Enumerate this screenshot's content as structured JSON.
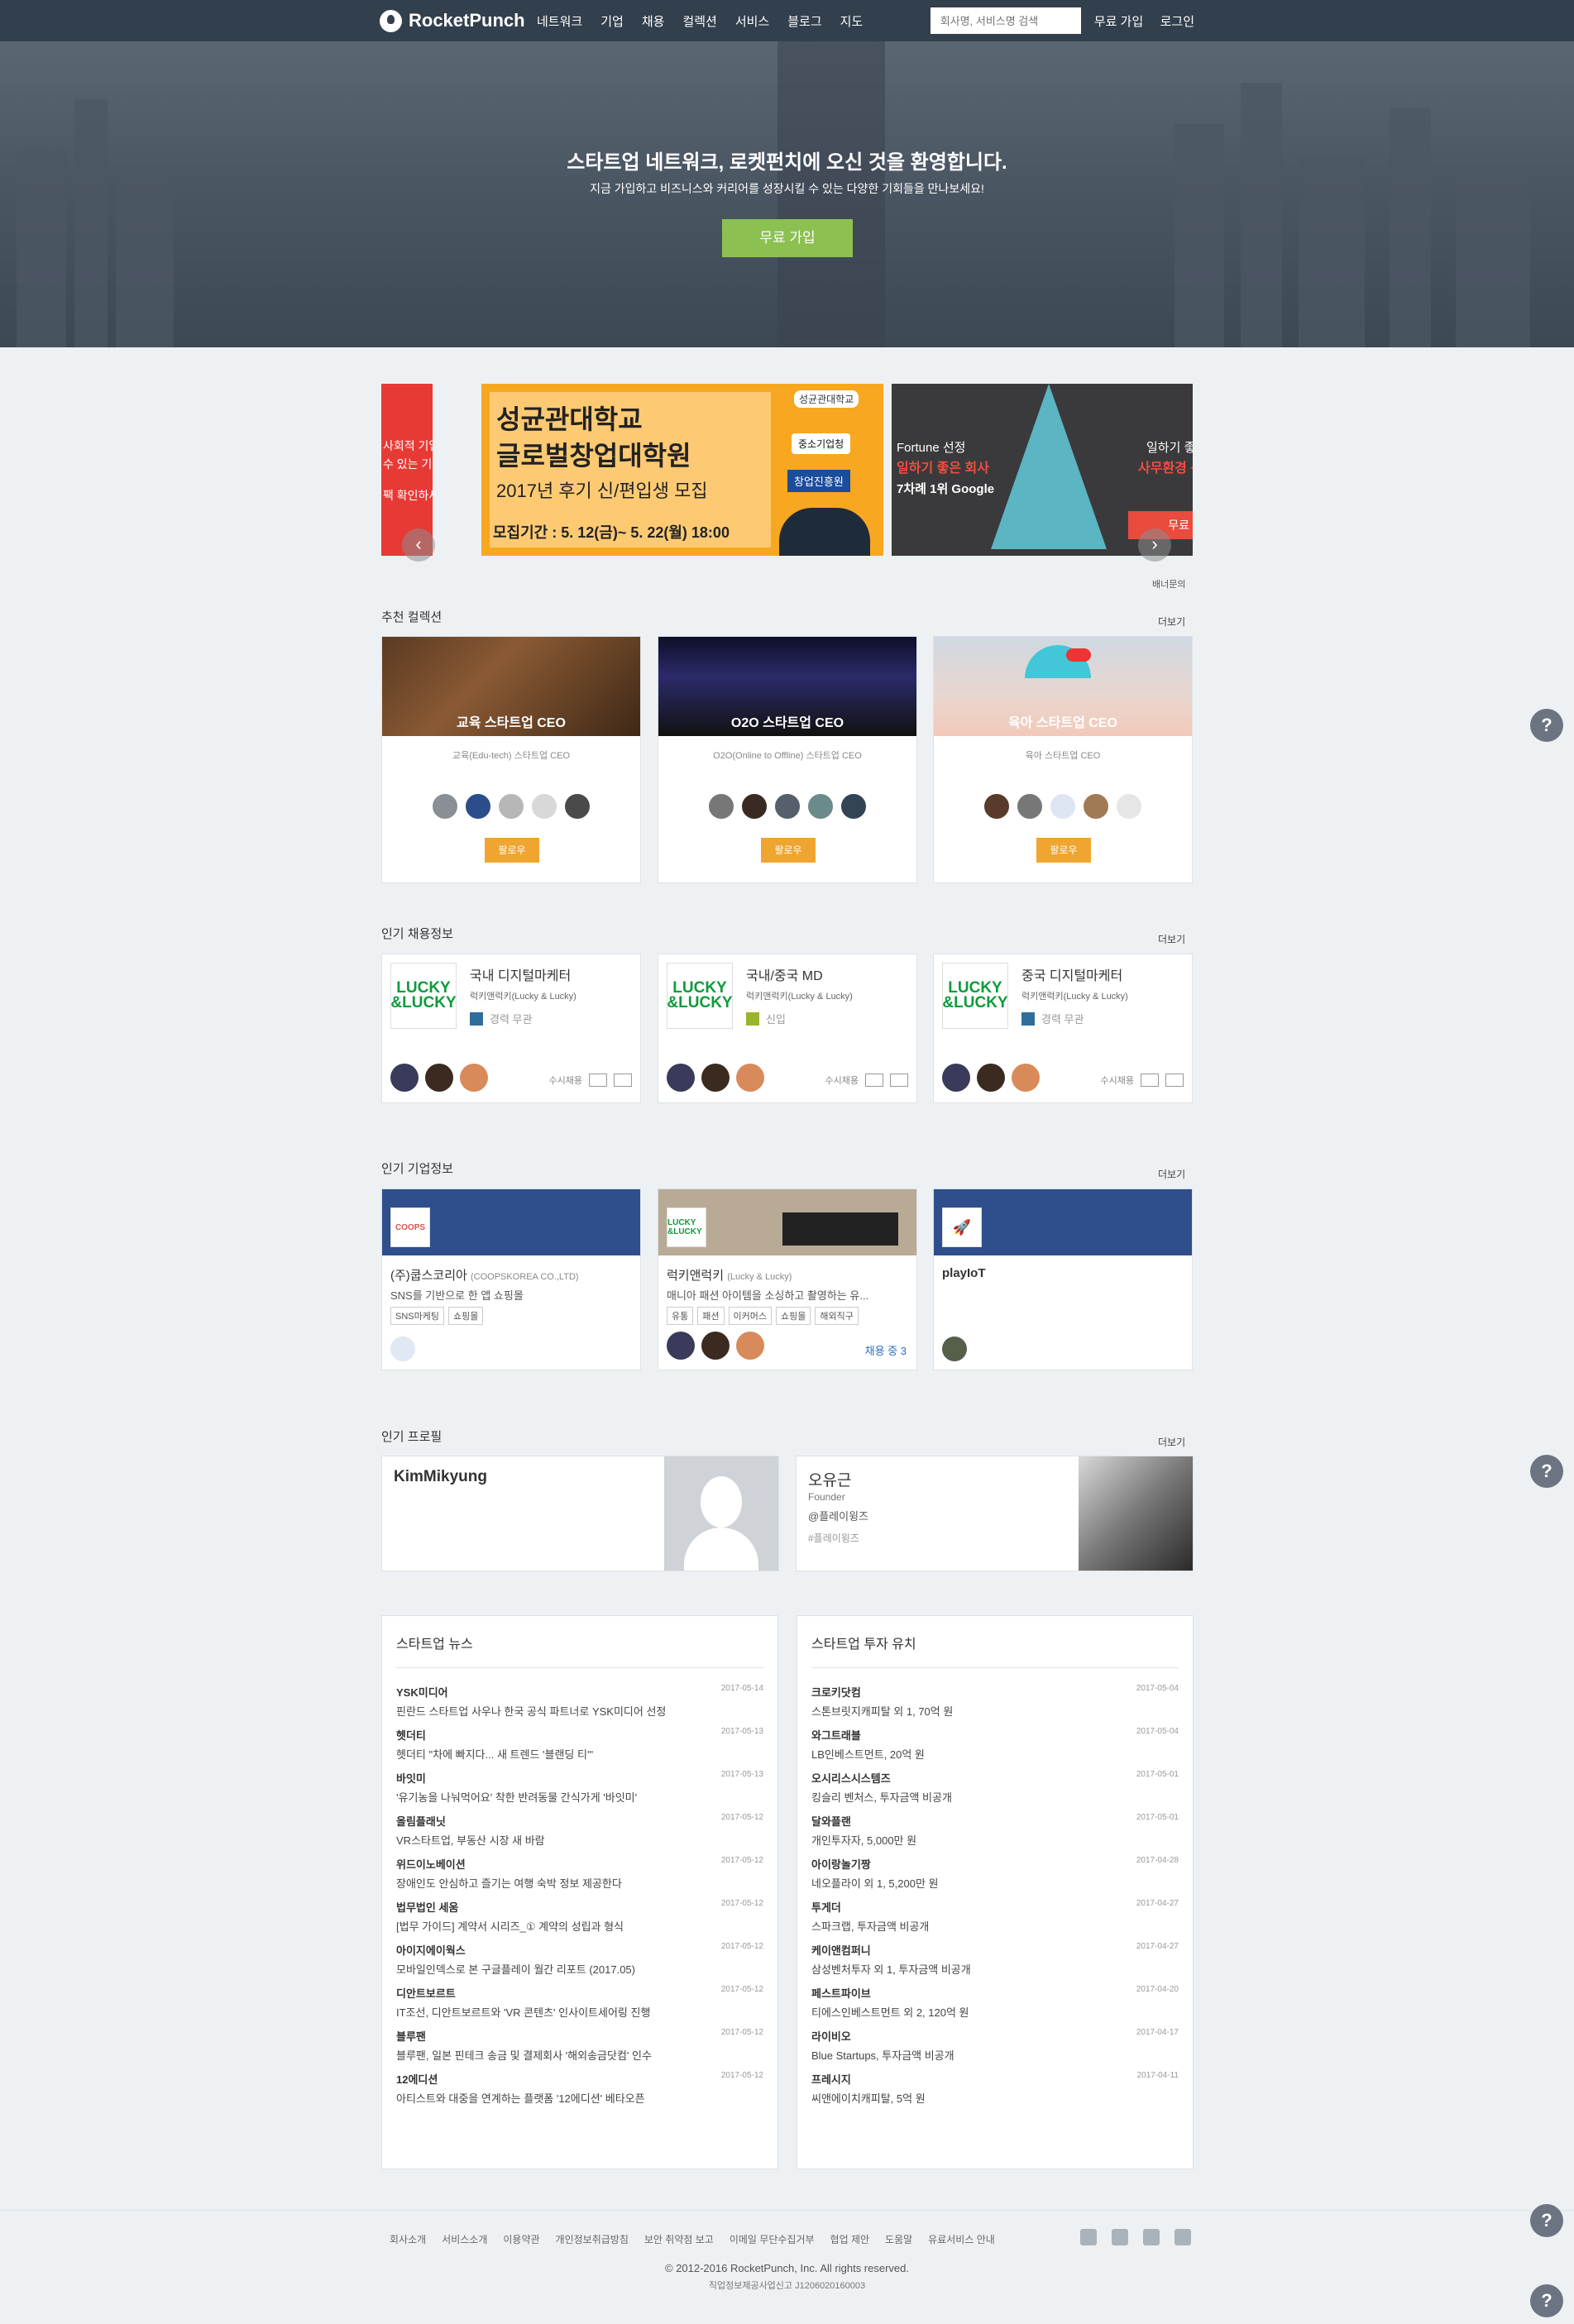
{
  "nav": {
    "logo": "RocketPunch",
    "menu": [
      "네트워크",
      "기업",
      "채용",
      "컬렉션",
      "서비스",
      "블로그",
      "지도"
    ],
    "search_placeholder": "회사명, 서비스명 검색",
    "signup": "무료 가입",
    "login": "로그인"
  },
  "hero": {
    "title": "스타트업 네트워크, 로켓펀치에 오신 것을 환영합니다.",
    "subtitle": "지금 가입하고 비즈니스와 커리어를 성장시킬 수 있는 다양한 기회들을 만나보세요!",
    "cta": "무료 가입"
  },
  "banners": {
    "left": {
      "line1": "사회적 기업을",
      "line2": "수 있는 기회!",
      "line3": "팩 확인하세요!"
    },
    "center": {
      "title1": "성균관대학교",
      "title2": "글로벌창업대학원",
      "sub": "2017년 후기 신/편입생 모집",
      "period": "모집기간 : 5. 12(금)~ 5. 22(월) 18:00",
      "badge1": "성균관대학교",
      "badge2": "중소기업청",
      "badge3": "창업진흥원"
    },
    "right": {
      "line1": "Fortune 선정",
      "line2": "일하기 좋은 회사",
      "line3": "7차례 1위 Google",
      "line4": "일하기 좋",
      "line5": "사무환경 선",
      "btn": "무료"
    },
    "inquiry": "배너문의",
    "prev": "‹",
    "next": "›"
  },
  "collections": {
    "title": "추천 컬렉션",
    "more": "더보기",
    "items": [
      {
        "name": "교육 스타트업 CEO",
        "desc": "교육(Edu-tech) 스타트업 CEO",
        "follow": "팔로우"
      },
      {
        "name": "O2O 스타트업 CEO",
        "desc": "O2O(Online to Offline) 스타트업 CEO",
        "follow": "팔로우"
      },
      {
        "name": "육아 스타트업 CEO",
        "desc": "육아 스타트업 CEO",
        "follow": "팔로우"
      }
    ]
  },
  "jobs": {
    "title": "인기 채용정보",
    "more": "더보기",
    "items": [
      {
        "logo": "LUCKY &LUCKY",
        "title": "국내 디지털마케터",
        "company": "럭키앤럭키(Lucky & Lucky)",
        "tag": "경력 무관",
        "recruit": "수시채용"
      },
      {
        "logo": "LUCKY &LUCKY",
        "title": "국내/중국 MD",
        "company": "럭키앤럭키(Lucky & Lucky)",
        "tag": "신입",
        "recruit": "수시채용"
      },
      {
        "logo": "LUCKY &LUCKY",
        "title": "중국 디지털마케터",
        "company": "럭키앤럭키(Lucky & Lucky)",
        "tag": "경력 무관",
        "recruit": "수시채용"
      }
    ]
  },
  "companies": {
    "title": "인기 기업정보",
    "more": "더보기",
    "items": [
      {
        "logo": "COOPS",
        "name": "(주)쿱스코리아",
        "eng": "(COOPSKOREA CO.,LTD)",
        "desc": "SNS를 기반으로 한 앱 쇼핑몰",
        "tags": [
          "SNS마케팅",
          "쇼핑몰"
        ],
        "hiring": ""
      },
      {
        "logo": "LUCKY &LUCKY",
        "name": "럭키앤럭키",
        "eng": "(Lucky & Lucky)",
        "desc": "매니아 패션 아이템을 소싱하고 촬영하는 유...",
        "tags": [
          "유통",
          "패션",
          "이커머스",
          "쇼핑몰",
          "해외직구"
        ],
        "hiring": "채용 중 3"
      },
      {
        "logo": "",
        "name": "playIoT",
        "eng": "",
        "desc": "",
        "tags": [],
        "hiring": ""
      }
    ]
  },
  "profiles": {
    "title": "인기 프로필",
    "more": "더보기",
    "items": [
      {
        "name": "KimMikyung",
        "role": "",
        "company": "",
        "tag": ""
      },
      {
        "name": "오유근",
        "role": "Founder",
        "company": "@플레이윙즈",
        "tag": "#플레이윙즈"
      }
    ]
  },
  "news": {
    "title": "스타트업 뉴스",
    "items": [
      {
        "t": "YSK미디어",
        "d": "핀란드 스타트업 사우나 한국 공식 파트너로 YSK미디어 선정",
        "date": "2017-05-14"
      },
      {
        "t": "헷더티",
        "d": "헷더티 \"차에 빠지다... 새 트렌드 '블랜딩 티'\"",
        "date": "2017-05-13"
      },
      {
        "t": "바잇미",
        "d": "'유기농을 나눠먹어요' 착한 반려동물 간식가게 '바잇미'",
        "date": "2017-05-13"
      },
      {
        "t": "올림플래닛",
        "d": "VR스타트업, 부동산 시장 새 바람",
        "date": "2017-05-12"
      },
      {
        "t": "위드이노베이션",
        "d": "장애인도 안심하고 즐기는 여행 숙박 정보 제공한다",
        "date": "2017-05-12"
      },
      {
        "t": "법무법인 세움",
        "d": "[법무 가이드] 계약서 시리즈_① 계약의 성립과 형식",
        "date": "2017-05-12"
      },
      {
        "t": "아이지에이웍스",
        "d": "모바일인덱스로 본 구글플레이 월간 리포트 (2017.05)",
        "date": "2017-05-12"
      },
      {
        "t": "디안트보르트",
        "d": "IT조선, 디안트보르트와 'VR 콘텐츠' 인사이트세어링 진행",
        "date": "2017-05-12"
      },
      {
        "t": "블루팬",
        "d": "블루팬, 일본 핀테크 송금 및 결제회사 '해외송금닷컴' 인수",
        "date": "2017-05-12"
      },
      {
        "t": "12에디션",
        "d": "아티스트와 대중을 연계하는 플랫폼 '12에디션' 베타오픈",
        "date": "2017-05-12"
      }
    ]
  },
  "invest": {
    "title": "스타트업 투자 유치",
    "items": [
      {
        "t": "크로키닷컴",
        "d": "스톤브릿지캐피탈 외 1, 70억 원",
        "date": "2017-05-04"
      },
      {
        "t": "와그트래블",
        "d": "LB인베스트먼트, 20억 원",
        "date": "2017-05-04"
      },
      {
        "t": "오시리스시스템즈",
        "d": "킹슬리 벤처스, 투자금액 비공개",
        "date": "2017-05-01"
      },
      {
        "t": "달와플랜",
        "d": "개인투자자, 5,000만 원",
        "date": "2017-05-01"
      },
      {
        "t": "아이랑놀기짱",
        "d": "네오플라이 외 1, 5,200만 원",
        "date": "2017-04-28"
      },
      {
        "t": "투게더",
        "d": "스파크랩, 투자금액 비공개",
        "date": "2017-04-27"
      },
      {
        "t": "케이앤컴퍼니",
        "d": "삼성벤처투자 외 1, 투자금액 비공개",
        "date": "2017-04-27"
      },
      {
        "t": "페스트파이브",
        "d": "티에스인베스트먼트 외 2, 120억 원",
        "date": "2017-04-20"
      },
      {
        "t": "라이비오",
        "d": "Blue Startups, 투자금액 비공개",
        "date": "2017-04-17"
      },
      {
        "t": "프레시지",
        "d": "씨앤에이치캐피탈, 5억 원",
        "date": "2017-04-11"
      }
    ]
  },
  "footer": {
    "links": [
      "회사소개",
      "서비스소개",
      "이용약관",
      "개인정보취급방침",
      "보안 취약점 보고",
      "이메일 무단수집거부",
      "협업 제안",
      "도움말",
      "유료서비스 안내"
    ],
    "copyright": "© 2012-2016 RocketPunch, Inc. All rights reserved.",
    "license": "직업정보제공사업신고 J1206020160003"
  },
  "help_icon": "?",
  "colors": {
    "nav": "#323f4d",
    "cta": "#8cc152",
    "follow": "#f0a530",
    "page_bg": "#eef1f4"
  }
}
